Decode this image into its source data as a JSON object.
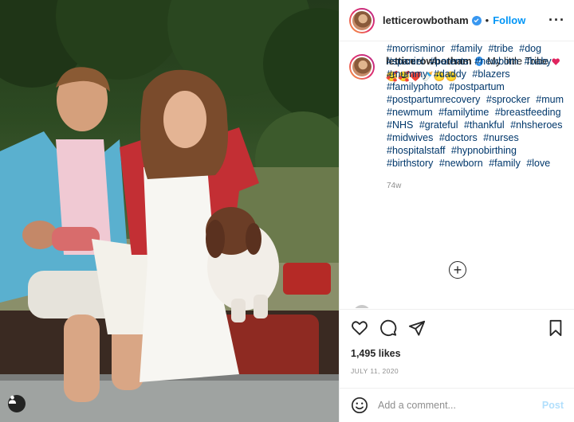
{
  "post": {
    "username": "letticerowbotham",
    "follow_label": "Follow",
    "dot": "•",
    "more_label": "···",
    "caption_message": "My little Tribe",
    "caption_emojis": "🥰🥰❤️🍼😶😶",
    "hashtags": [
      "#morrisminor",
      "#family",
      "#tribe",
      "#dog",
      "#spaniel",
      "#parents",
      "#newborn",
      "#baby",
      "#mummy",
      "#daddy",
      "#blazers",
      "#familyphoto",
      "#postpartum",
      "#postpartumrecovery",
      "#sprocker",
      "#mum",
      "#newmum",
      "#familytime",
      "#breastfeeding",
      "#NHS",
      "#grateful",
      "#thankful",
      "#nhsheroes",
      "#midwives",
      "#doctors",
      "#nurses",
      "#hospitalstaff",
      "#hypnobirthing",
      "#birthstory",
      "#newborn",
      "#family",
      "#love"
    ],
    "time_ago": "74w",
    "load_more": "+",
    "likes": "1,495 likes",
    "date": "JULY 11, 2020",
    "comment_placeholder": "Add a comment...",
    "post_label": "Post"
  },
  "colors": {
    "follow": "#0095f6",
    "hashtag": "#00376b",
    "post_disabled": "#b2dffc",
    "verified": "#3897f0",
    "heart": "#ed4956"
  },
  "icons": [
    "verified-badge-icon",
    "more-options-icon",
    "heart-icon",
    "comment-icon",
    "share-icon",
    "save-icon",
    "emoji-icon",
    "add-icon",
    "tag-user-icon"
  ]
}
